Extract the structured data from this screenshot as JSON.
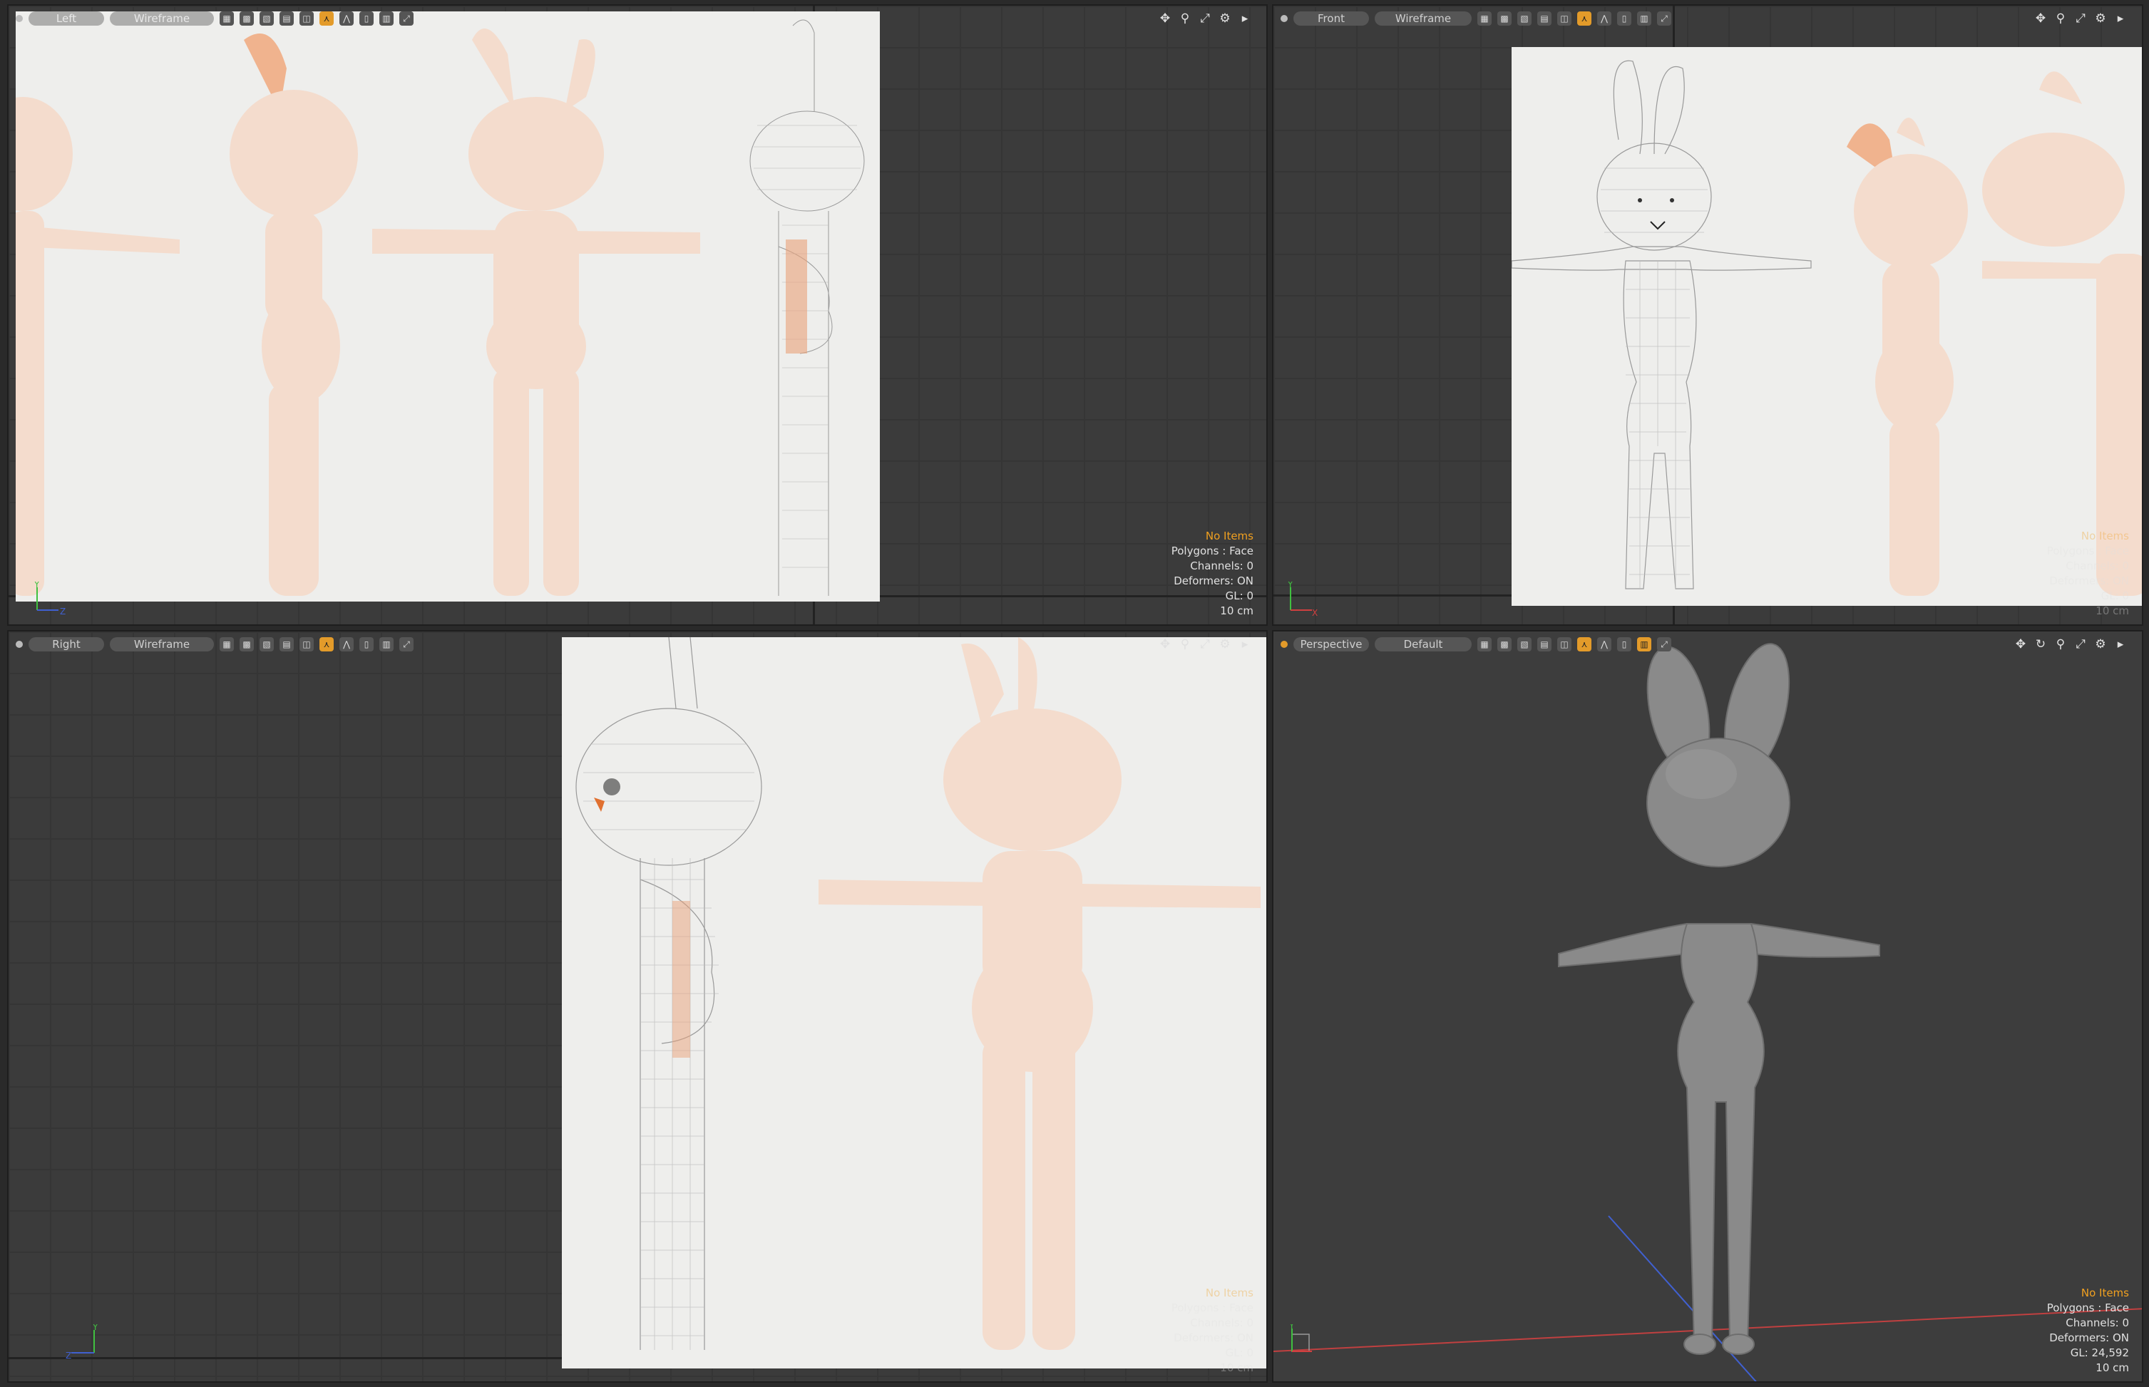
{
  "viewports": {
    "left": {
      "view_label": "Left",
      "shading_label": "Wireframe",
      "info": [
        "No Items",
        "Polygons : Face",
        "Channels: 0",
        "Deformers: ON",
        "GL: 0",
        "10 cm"
      ]
    },
    "front": {
      "view_label": "Front",
      "shading_label": "Wireframe",
      "info": [
        "No Items",
        "Polygons : Face",
        "Channels: 0",
        "Deformers: ON",
        "GL: 0",
        "10 cm"
      ]
    },
    "right": {
      "view_label": "Right",
      "shading_label": "Wireframe",
      "info": [
        "No Items",
        "Polygons : Face",
        "Channels: 0",
        "Deformers: ON",
        "GL: 0",
        "10 cm"
      ]
    },
    "perspective": {
      "view_label": "Perspective",
      "shading_label": "Default",
      "info": [
        "No Items",
        "Polygons : Face",
        "Channels: 0",
        "Deformers: ON",
        "GL: 24,592",
        "10 cm"
      ]
    }
  },
  "axes": {
    "y": "Y",
    "z": "Z",
    "x": "X"
  },
  "colors": {
    "accent": "#f0a020",
    "viewport_bg": "#3b3b3b",
    "reference_bg": "#eeeeec",
    "reference_figure": "#f4dccd",
    "mesh_gray": "#8a8a8a",
    "x_axis": "#d04040",
    "y_axis": "#40c040",
    "z_axis": "#4060d0"
  }
}
